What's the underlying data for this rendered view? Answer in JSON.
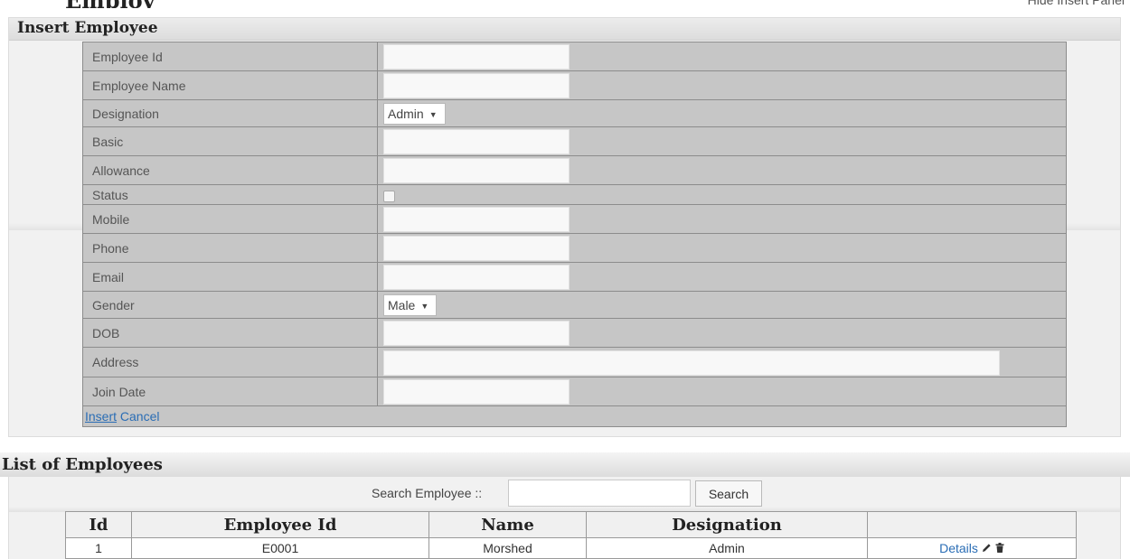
{
  "page": {
    "title_partial": "Employ",
    "hide_link_partial": "Hide Insert Panel"
  },
  "insert_panel": {
    "title": "Insert Employee",
    "fields": {
      "employee_id": {
        "label": "Employee Id",
        "value": ""
      },
      "employee_name": {
        "label": "Employee Name",
        "value": ""
      },
      "designation": {
        "label": "Designation",
        "selected": "Admin"
      },
      "basic": {
        "label": "Basic",
        "value": ""
      },
      "allowance": {
        "label": "Allowance",
        "value": ""
      },
      "status": {
        "label": "Status",
        "checked": false
      },
      "mobile": {
        "label": "Mobile",
        "value": ""
      },
      "phone": {
        "label": "Phone",
        "value": ""
      },
      "email": {
        "label": "Email",
        "value": ""
      },
      "gender": {
        "label": "Gender",
        "selected": "Male"
      },
      "dob": {
        "label": "DOB",
        "value": ""
      },
      "address": {
        "label": "Address",
        "value": ""
      },
      "join_date": {
        "label": "Join Date",
        "value": ""
      }
    },
    "actions": {
      "insert": "Insert",
      "cancel": "Cancel"
    }
  },
  "list_panel": {
    "title": "List of Employees",
    "search_label": "Search Employee ::",
    "search_value": "",
    "search_button": "Search",
    "columns": [
      "Id",
      "Employee Id",
      "Name",
      "Designation",
      ""
    ],
    "rows": [
      {
        "id": "1",
        "employee_id": "E0001",
        "name": "Morshed",
        "designation": "Admin",
        "details": "Details"
      }
    ]
  },
  "icons": {
    "edit": "pencil-icon",
    "delete": "trash-icon"
  },
  "colors": {
    "link": "#2a6db5",
    "row_bg": "#c6c6c6"
  }
}
